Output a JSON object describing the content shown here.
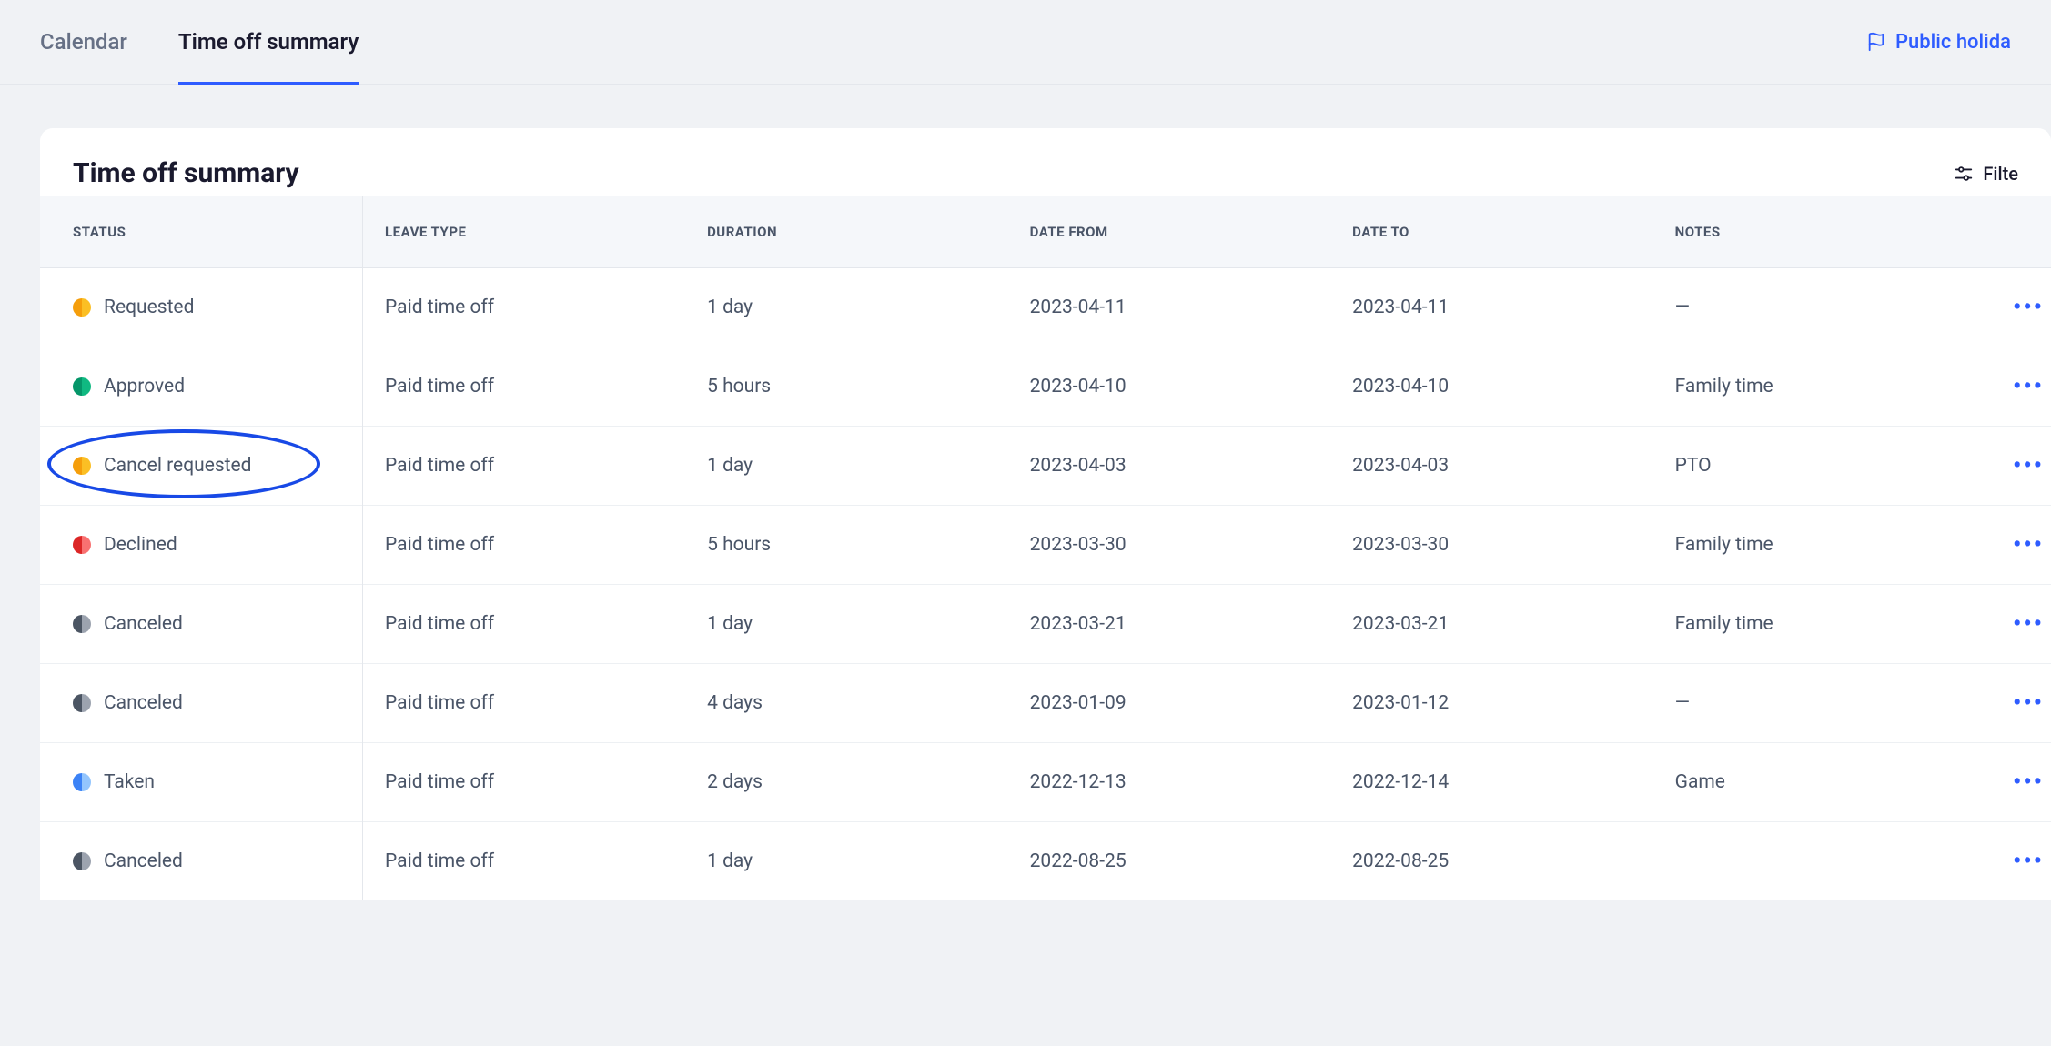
{
  "nav": {
    "tabs": [
      {
        "label": "Calendar",
        "active": false
      },
      {
        "label": "Time off summary",
        "active": true
      }
    ],
    "public_holidays_label": "Public holida"
  },
  "card": {
    "title": "Time off summary",
    "filters_label": "Filte"
  },
  "table": {
    "columns": {
      "status": "STATUS",
      "leave_type": "LEAVE TYPE",
      "duration": "DURATION",
      "date_from": "DATE FROM",
      "date_to": "DATE TO",
      "notes": "NOTES"
    },
    "rows": [
      {
        "status": "Requested",
        "status_color": "orange",
        "leave_type": "Paid time off",
        "duration": "1 day",
        "date_from": "2023-04-11",
        "date_to": "2023-04-11",
        "notes": "—",
        "highlighted": false
      },
      {
        "status": "Approved",
        "status_color": "green",
        "leave_type": "Paid time off",
        "duration": "5 hours",
        "date_from": "2023-04-10",
        "date_to": "2023-04-10",
        "notes": "Family time",
        "highlighted": false
      },
      {
        "status": "Cancel requested",
        "status_color": "orange",
        "leave_type": "Paid time off",
        "duration": "1 day",
        "date_from": "2023-04-03",
        "date_to": "2023-04-03",
        "notes": "PTO",
        "highlighted": true
      },
      {
        "status": "Declined",
        "status_color": "red",
        "leave_type": "Paid time off",
        "duration": "5 hours",
        "date_from": "2023-03-30",
        "date_to": "2023-03-30",
        "notes": "Family time",
        "highlighted": false
      },
      {
        "status": "Canceled",
        "status_color": "gray",
        "leave_type": "Paid time off",
        "duration": "1 day",
        "date_from": "2023-03-21",
        "date_to": "2023-03-21",
        "notes": "Family time",
        "highlighted": false
      },
      {
        "status": "Canceled",
        "status_color": "gray",
        "leave_type": "Paid time off",
        "duration": "4 days",
        "date_from": "2023-01-09",
        "date_to": "2023-01-12",
        "notes": "—",
        "highlighted": false
      },
      {
        "status": "Taken",
        "status_color": "blue",
        "leave_type": "Paid time off",
        "duration": "2 days",
        "date_from": "2022-12-13",
        "date_to": "2022-12-14",
        "notes": "Game",
        "highlighted": false
      },
      {
        "status": "Canceled",
        "status_color": "gray",
        "leave_type": "Paid time off",
        "duration": "1 day",
        "date_from": "2022-08-25",
        "date_to": "2022-08-25",
        "notes": "",
        "highlighted": false
      }
    ]
  }
}
